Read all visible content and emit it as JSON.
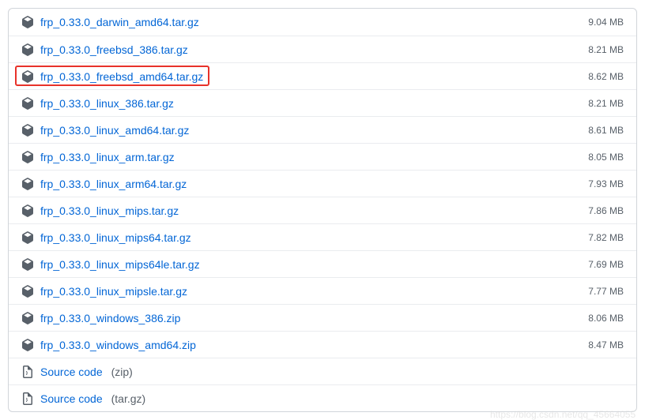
{
  "assets": [
    {
      "name": "frp_0.33.0_darwin_amd64.tar.gz",
      "size": "9.04 MB",
      "type": "package"
    },
    {
      "name": "frp_0.33.0_freebsd_386.tar.gz",
      "size": "8.21 MB",
      "type": "package"
    },
    {
      "name": "frp_0.33.0_freebsd_amd64.tar.gz",
      "size": "8.62 MB",
      "type": "package",
      "highlighted": true
    },
    {
      "name": "frp_0.33.0_linux_386.tar.gz",
      "size": "8.21 MB",
      "type": "package"
    },
    {
      "name": "frp_0.33.0_linux_amd64.tar.gz",
      "size": "8.61 MB",
      "type": "package"
    },
    {
      "name": "frp_0.33.0_linux_arm.tar.gz",
      "size": "8.05 MB",
      "type": "package"
    },
    {
      "name": "frp_0.33.0_linux_arm64.tar.gz",
      "size": "7.93 MB",
      "type": "package"
    },
    {
      "name": "frp_0.33.0_linux_mips.tar.gz",
      "size": "7.86 MB",
      "type": "package"
    },
    {
      "name": "frp_0.33.0_linux_mips64.tar.gz",
      "size": "7.82 MB",
      "type": "package"
    },
    {
      "name": "frp_0.33.0_linux_mips64le.tar.gz",
      "size": "7.69 MB",
      "type": "package"
    },
    {
      "name": "frp_0.33.0_linux_mipsle.tar.gz",
      "size": "7.77 MB",
      "type": "package"
    },
    {
      "name": "frp_0.33.0_windows_386.zip",
      "size": "8.06 MB",
      "type": "package"
    },
    {
      "name": "frp_0.33.0_windows_amd64.zip",
      "size": "8.47 MB",
      "type": "package"
    },
    {
      "name": "Source code",
      "extra": "(zip)",
      "size": "",
      "type": "source"
    },
    {
      "name": "Source code",
      "extra": "(tar.gz)",
      "size": "",
      "type": "source"
    }
  ],
  "watermark": "https://blog.csdn.net/qq_45664055"
}
